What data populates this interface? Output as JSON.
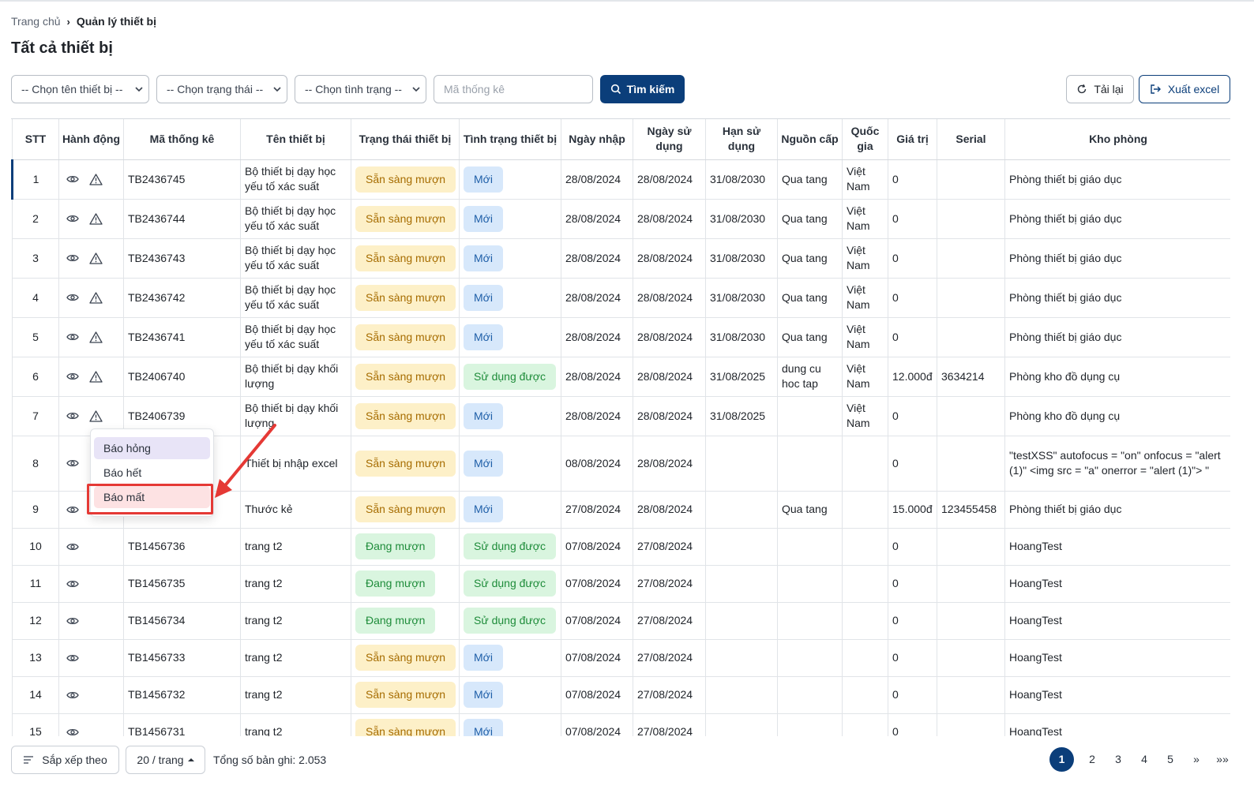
{
  "breadcrumb": {
    "home": "Trang chủ",
    "current": "Quản lý thiết bị"
  },
  "page_title": "Tất cả thiết bị",
  "filters": {
    "device_name": "-- Chọn tên thiết bị --",
    "status": "-- Chọn trạng thái --",
    "condition": "-- Chọn tình trạng --",
    "code_placeholder": "Mã thống kê",
    "search_label": "Tìm kiếm",
    "reload_label": "Tải lại",
    "export_label": "Xuất excel"
  },
  "table": {
    "headers": [
      "STT",
      "Hành động",
      "Mã thống kê",
      "Tên thiết bị",
      "Trạng thái thiết bị",
      "Tình trạng thiết bị",
      "Ngày nhập",
      "Ngày sử dụng",
      "Hạn sử dụng",
      "Nguồn cấp",
      "Quốc gia",
      "Giá trị",
      "Serial",
      "Kho phòng"
    ],
    "rows": [
      {
        "stt": "1",
        "code": "TB2436745",
        "name": "Bộ thiết bị dạy học yếu tố xác suất",
        "status": "Sẵn sàng mượn",
        "condition": "Mới",
        "import_date": "28/08/2024",
        "use_date": "28/08/2024",
        "expiry": "31/08/2030",
        "source": "Qua tang",
        "country": "Việt Nam",
        "value": "0",
        "serial": "",
        "room": "Phòng thiết bị giáo dục"
      },
      {
        "stt": "2",
        "code": "TB2436744",
        "name": "Bộ thiết bị dạy học yếu tố xác suất",
        "status": "Sẵn sàng mượn",
        "condition": "Mới",
        "import_date": "28/08/2024",
        "use_date": "28/08/2024",
        "expiry": "31/08/2030",
        "source": "Qua tang",
        "country": "Việt Nam",
        "value": "0",
        "serial": "",
        "room": "Phòng thiết bị giáo dục"
      },
      {
        "stt": "3",
        "code": "TB2436743",
        "name": "Bộ thiết bị dạy học yếu tố xác suất",
        "status": "Sẵn sàng mượn",
        "condition": "Mới",
        "import_date": "28/08/2024",
        "use_date": "28/08/2024",
        "expiry": "31/08/2030",
        "source": "Qua tang",
        "country": "Việt Nam",
        "value": "0",
        "serial": "",
        "room": "Phòng thiết bị giáo dục"
      },
      {
        "stt": "4",
        "code": "TB2436742",
        "name": "Bộ thiết bị dạy học yếu tố xác suất",
        "status": "Sẵn sàng mượn",
        "condition": "Mới",
        "import_date": "28/08/2024",
        "use_date": "28/08/2024",
        "expiry": "31/08/2030",
        "source": "Qua tang",
        "country": "Việt Nam",
        "value": "0",
        "serial": "",
        "room": "Phòng thiết bị giáo dục"
      },
      {
        "stt": "5",
        "code": "TB2436741",
        "name": "Bộ thiết bị dạy học yếu tố xác suất",
        "status": "Sẵn sàng mượn",
        "condition": "Mới",
        "import_date": "28/08/2024",
        "use_date": "28/08/2024",
        "expiry": "31/08/2030",
        "source": "Qua tang",
        "country": "Việt Nam",
        "value": "0",
        "serial": "",
        "room": "Phòng thiết bị giáo dục"
      },
      {
        "stt": "6",
        "code": "TB2406740",
        "name": "Bộ thiết bị dạy khối lượng",
        "status": "Sẵn sàng mượn",
        "condition": "Sử dụng được",
        "import_date": "28/08/2024",
        "use_date": "28/08/2024",
        "expiry": "31/08/2025",
        "source": "dung cu hoc tap",
        "country": "Việt Nam",
        "value": "12.000đ",
        "serial": "3634214",
        "room": "Phòng kho đồ dụng cụ"
      },
      {
        "stt": "7",
        "code": "TB2406739",
        "name": "Bộ thiết bị dạy khối lượng",
        "status": "Sẵn sàng mượn",
        "condition": "Mới",
        "import_date": "28/08/2024",
        "use_date": "28/08/2024",
        "expiry": "31/08/2025",
        "source": "",
        "country": "Việt Nam",
        "value": "0",
        "serial": "",
        "room": "Phòng kho đồ dụng cụ"
      },
      {
        "stt": "8",
        "code": "",
        "name": "Thiết bị nhập excel",
        "status": "Sẵn sàng mượn",
        "condition": "Mới",
        "import_date": "08/08/2024",
        "use_date": "28/08/2024",
        "expiry": "",
        "source": "",
        "country": "",
        "value": "0",
        "serial": "",
        "room": "\"testXSS\" autofocus = \"on\" onfocus = \"alert (1)\" <img src = \"a\" onerror = \"alert (1)\"> \""
      },
      {
        "stt": "9",
        "code": "",
        "name": "Thước kẻ",
        "status": "Sẵn sàng mượn",
        "condition": "Mới",
        "import_date": "27/08/2024",
        "use_date": "28/08/2024",
        "expiry": "",
        "source": "Qua tang",
        "country": "",
        "value": "15.000đ",
        "serial": "123455458",
        "room": "Phòng thiết bị giáo dục"
      },
      {
        "stt": "10",
        "code": "TB1456736",
        "name": "trang t2",
        "status": "Đang mượn",
        "condition": "Sử dụng được",
        "import_date": "07/08/2024",
        "use_date": "27/08/2024",
        "expiry": "",
        "source": "",
        "country": "",
        "value": "0",
        "serial": "",
        "room": "HoangTest"
      },
      {
        "stt": "11",
        "code": "TB1456735",
        "name": "trang t2",
        "status": "Đang mượn",
        "condition": "Sử dụng được",
        "import_date": "07/08/2024",
        "use_date": "27/08/2024",
        "expiry": "",
        "source": "",
        "country": "",
        "value": "0",
        "serial": "",
        "room": "HoangTest"
      },
      {
        "stt": "12",
        "code": "TB1456734",
        "name": "trang t2",
        "status": "Đang mượn",
        "condition": "Sử dụng được",
        "import_date": "07/08/2024",
        "use_date": "27/08/2024",
        "expiry": "",
        "source": "",
        "country": "",
        "value": "0",
        "serial": "",
        "room": "HoangTest"
      },
      {
        "stt": "13",
        "code": "TB1456733",
        "name": "trang t2",
        "status": "Sẵn sàng mượn",
        "condition": "Mới",
        "import_date": "07/08/2024",
        "use_date": "27/08/2024",
        "expiry": "",
        "source": "",
        "country": "",
        "value": "0",
        "serial": "",
        "room": "HoangTest"
      },
      {
        "stt": "14",
        "code": "TB1456732",
        "name": "trang t2",
        "status": "Sẵn sàng mượn",
        "condition": "Mới",
        "import_date": "07/08/2024",
        "use_date": "27/08/2024",
        "expiry": "",
        "source": "",
        "country": "",
        "value": "0",
        "serial": "",
        "room": "HoangTest"
      },
      {
        "stt": "15",
        "code": "TB1456731",
        "name": "trang t2",
        "status": "Sẵn sàng mượn",
        "condition": "Mới",
        "import_date": "07/08/2024",
        "use_date": "27/08/2024",
        "expiry": "",
        "source": "",
        "country": "",
        "value": "0",
        "serial": "",
        "room": "HoangTest"
      }
    ]
  },
  "action_menu": {
    "items": [
      "Báo hỏng",
      "Báo hết",
      "Báo mất"
    ]
  },
  "footer": {
    "sort_label": "Sắp xếp theo",
    "page_size": "20 / trang",
    "total": "Tổng số bản ghi: 2.053",
    "pages": [
      "1",
      "2",
      "3",
      "4",
      "5"
    ],
    "next": "»",
    "last": "»»"
  },
  "colors": {
    "primary": "#0b3e7a",
    "status_ready_bg": "#fdf0c8",
    "status_borrowed_bg": "#d9f5df",
    "condition_new_bg": "#d7e8fb",
    "highlight": "#e53935"
  }
}
